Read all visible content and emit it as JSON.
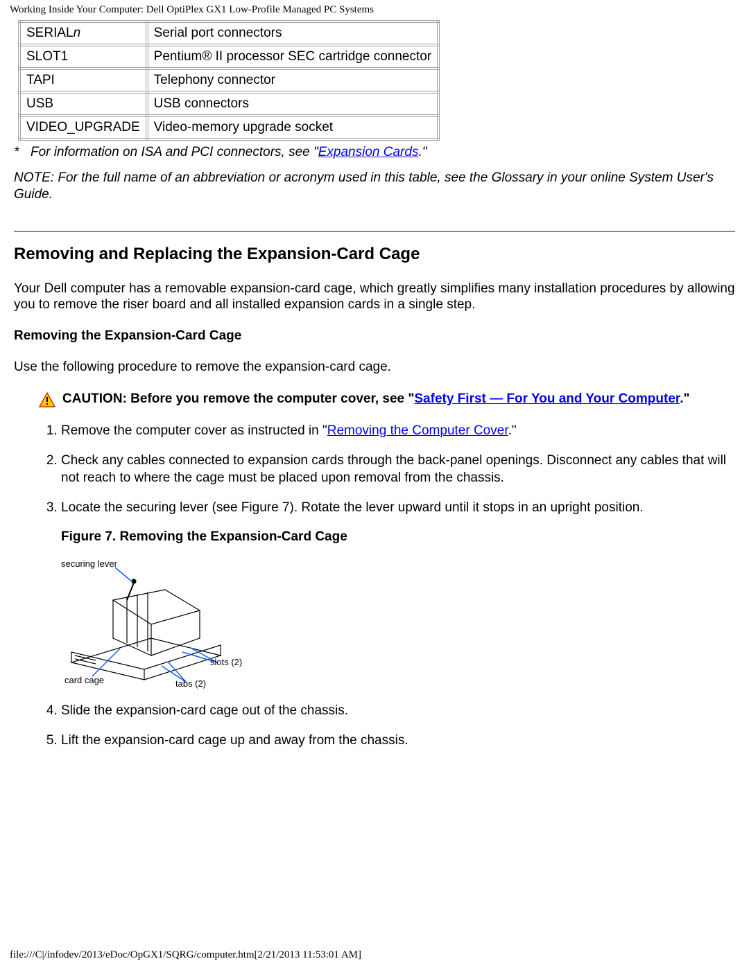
{
  "header_path": "Working Inside Your Computer: Dell OptiPlex GX1 Low-Profile Managed PC Systems",
  "table_rows": [
    {
      "label_prefix": "SERIAL",
      "label_suffix_italic": "n",
      "desc": "Serial port connectors"
    },
    {
      "label": "SLOT1",
      "desc": "Pentium® II processor SEC cartridge connector"
    },
    {
      "label": "TAPI",
      "desc": "Telephony connector"
    },
    {
      "label": "USB",
      "desc": "USB connectors"
    },
    {
      "label": "VIDEO_UPGRADE",
      "desc": "Video-memory upgrade socket"
    }
  ],
  "footnote": {
    "star": "*",
    "before_link": "For information on ISA and PCI connectors, see \"",
    "link": "Expansion Cards",
    "after_link": ".\""
  },
  "note_text": "NOTE: For the full name of an abbreviation or acronym used in this table, see the Glossary in your online System User's Guide.",
  "section_title": "Removing and Replacing the Expansion-Card Cage",
  "intro_para": "Your Dell computer has a removable expansion-card cage, which greatly simplifies many installation procedures by allowing you to remove the riser board and all installed expansion cards in a single step.",
  "subsection_title": "Removing the Expansion-Card Cage",
  "subsection_intro": "Use the following procedure to remove the expansion-card cage.",
  "caution": {
    "before_link": "CAUTION: Before you remove the computer cover, see \"",
    "link": "Safety First — For You and Your Computer",
    "after_link": ".\""
  },
  "steps": {
    "s1_before": "Remove the computer cover as instructed in \"",
    "s1_link": "Removing the Computer Cover",
    "s1_after": ".\"",
    "s2": "Check any cables connected to expansion cards through the back-panel openings. Disconnect any cables that will not reach to where the cage must be placed upon removal from the chassis.",
    "s3": "Locate the securing lever (see Figure 7). Rotate the lever upward until it stops in an upright position.",
    "fig_caption": "Figure 7. Removing the Expansion-Card Cage",
    "fig_labels": {
      "securing_lever": "securing lever",
      "card_cage": "card cage",
      "slots": "slots (2)",
      "tabs": "tabs (2)"
    },
    "s4": "Slide the expansion-card cage out of the chassis.",
    "s5": "Lift the expansion-card cage up and away from the chassis."
  },
  "footer_path": "file:///C|/infodev/2013/eDoc/OpGX1/SQRG/computer.htm[2/21/2013 11:53:01 AM]"
}
